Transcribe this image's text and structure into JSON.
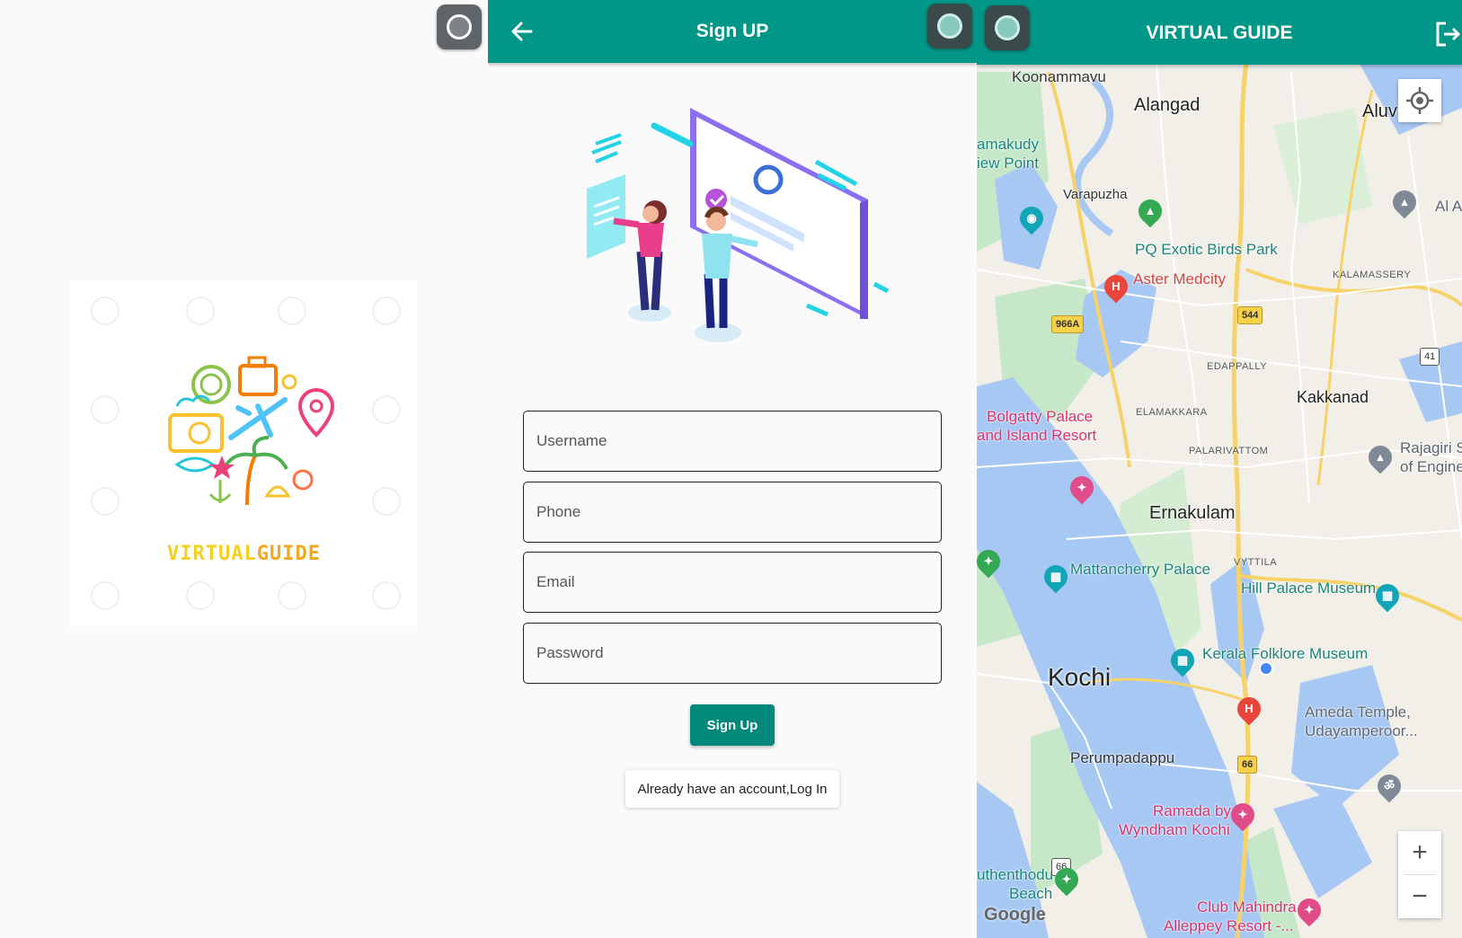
{
  "panel_welcome": {
    "logo_text_part1": "VIRTUAL",
    "logo_text_part2": "GUIDE"
  },
  "panel_signup": {
    "title": "Sign UP",
    "fields": {
      "username_placeholder": "Username",
      "phone_placeholder": "Phone",
      "email_placeholder": "Email",
      "password_placeholder": "Password"
    },
    "signup_button": "Sign Up",
    "login_link": "Already have an account,Log In"
  },
  "panel_map": {
    "title": "VIRTUAL GUIDE",
    "labels": {
      "koonammavu": "Koonammavu",
      "alangad": "Alangad",
      "aluva": "Aluva",
      "amakudy": "amakudy",
      "iew_point": "iew Point",
      "varapuzha": "Varapuzha",
      "al_a": "Al A",
      "pq_birds": "PQ Exotic Birds Park",
      "aster": "Aster Medcity",
      "kalamassery": "KALAMASSERY",
      "edappally": "EDAPPALLY",
      "kakkanad": "Kakkanad",
      "elamakkara": "ELAMAKKARA",
      "bolgatty1": "Bolgatty Palace",
      "bolgatty2": "and Island Resort",
      "palarivattom": "PALARIVATTOM",
      "rajagiri1": "Rajagiri S",
      "rajagiri2": "of Engine",
      "ernakulam": "Ernakulam",
      "mattancherry": "Mattancherry Palace",
      "vyttila": "VYTTILA",
      "hill_palace": "Hill Palace Museum",
      "kerala_folklore": "Kerala Folklore Museum",
      "kochi": "Kochi",
      "ameda1": "Ameda Temple,",
      "ameda2": "Udayamperoor...",
      "perumpadappu": "Perumpadappu",
      "ramada1": "Ramada by",
      "ramada2": "Wyndham Kochi",
      "thenthodu1": "uthenthodu",
      "thenthodu2": "Beach",
      "club1": "Club Mahindra",
      "club2": "Alleppey Resort -...",
      "google": "Google"
    },
    "shields": {
      "r966a": "966A",
      "r544": "544",
      "r41": "41",
      "r66a": "66",
      "r66b": "66"
    },
    "zoom_in": "+",
    "zoom_out": "−"
  },
  "colors": {
    "primary": "#009688",
    "button": "#00897b",
    "water": "#a8c8f4",
    "land": "#f1efe8",
    "green": "#c6e8c9",
    "road_major": "#f7d269"
  }
}
